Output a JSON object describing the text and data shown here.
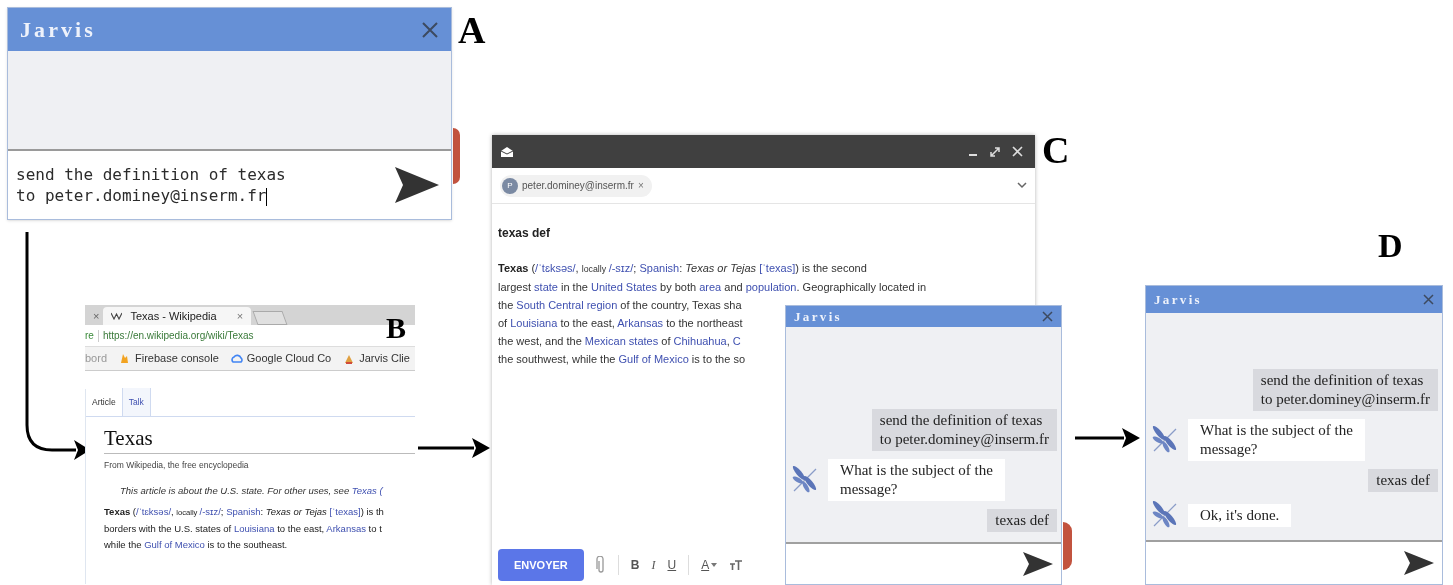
{
  "panel_a": {
    "label": "A",
    "chat": {
      "title": "Jarvis",
      "input": {
        "value": "send the definition of texas\nto peter.dominey@inserm.fr"
      }
    }
  },
  "panel_b": {
    "label": "B",
    "tabs": [
      {
        "label": "×",
        "selected": false
      },
      {
        "label": "Texas - Wikipedia",
        "close": "×",
        "selected": true
      }
    ],
    "address": {
      "security": "re",
      "url": "https://en.wikipedia.org/wiki/Texas"
    },
    "bookmarks": [
      {
        "label": "bord",
        "kind": "plain"
      },
      {
        "label": "Firebase console",
        "kind": "flame"
      },
      {
        "label": "Google Cloud Co",
        "kind": "cloud"
      },
      {
        "label": "Jarvis Clie",
        "kind": "app"
      }
    ],
    "page_tabs": [
      {
        "label": "Article",
        "selected": true
      },
      {
        "label": "Talk",
        "selected": false
      }
    ],
    "heading": "Texas",
    "tagline": "From Wikipedia, the free encyclopedia",
    "hatnote": [
      {
        "text": "This article is about the U.S. state. For other uses, see ",
        "kind": "plain"
      },
      {
        "text": "Texas (",
        "kind": "link"
      }
    ],
    "paragraph": [
      [
        {
          "text": "Texas",
          "kind": "bold"
        },
        {
          "text": " (",
          "kind": "plain"
        },
        {
          "text": "/ˈtɛksəs/",
          "kind": "link"
        },
        {
          "text": ", ",
          "kind": "plain"
        },
        {
          "text": "locally ",
          "kind": "small"
        },
        {
          "text": "/-sɪz/",
          "kind": "link"
        },
        {
          "text": "; ",
          "kind": "plain"
        },
        {
          "text": "Spanish",
          "kind": "link"
        },
        {
          "text": ": ",
          "kind": "plain"
        },
        {
          "text": "Texas or Tejas ",
          "kind": "italic"
        },
        {
          "text": "[ˈtexas]",
          "kind": "link"
        },
        {
          "text": ") is th",
          "kind": "plain"
        }
      ],
      [
        {
          "text": "borders with the U.S. states of ",
          "kind": "plain"
        },
        {
          "text": "Louisiana",
          "kind": "link"
        },
        {
          "text": " to the east, ",
          "kind": "plain"
        },
        {
          "text": "Arkansas",
          "kind": "link"
        },
        {
          "text": " to t",
          "kind": "plain"
        }
      ],
      [
        {
          "text": "while the ",
          "kind": "plain"
        },
        {
          "text": "Gulf of Mexico",
          "kind": "link"
        },
        {
          "text": " is to the southeast.",
          "kind": "plain"
        }
      ]
    ]
  },
  "panel_c": {
    "label": "C",
    "recipient": {
      "initial": "P",
      "email": "peter.dominey@inserm.fr",
      "remove": "×"
    },
    "subject": "texas def",
    "body": [
      [
        {
          "text": "Texas",
          "kind": "bold"
        },
        {
          "text": " (",
          "kind": "plain"
        },
        {
          "text": "/ˈtɛksəs/",
          "kind": "link"
        },
        {
          "text": ", ",
          "kind": "plain"
        },
        {
          "text": "locally ",
          "kind": "small"
        },
        {
          "text": "/-sɪz/",
          "kind": "link"
        },
        {
          "text": "; ",
          "kind": "plain"
        },
        {
          "text": "Spanish",
          "kind": "link"
        },
        {
          "text": ": ",
          "kind": "plain"
        },
        {
          "text": "Texas or Tejas ",
          "kind": "italic"
        },
        {
          "text": "[ˈtexas]",
          "kind": "link"
        },
        {
          "text": ") is the second",
          "kind": "plain"
        }
      ],
      [
        {
          "text": "largest ",
          "kind": "plain"
        },
        {
          "text": "state",
          "kind": "link"
        },
        {
          "text": " in the ",
          "kind": "plain"
        },
        {
          "text": "United States",
          "kind": "link"
        },
        {
          "text": " by both ",
          "kind": "plain"
        },
        {
          "text": "area",
          "kind": "link"
        },
        {
          "text": " and ",
          "kind": "plain"
        },
        {
          "text": "population",
          "kind": "link"
        },
        {
          "text": ". Geographically located in",
          "kind": "plain"
        }
      ],
      [
        {
          "text": "the ",
          "kind": "plain"
        },
        {
          "text": "South Central region",
          "kind": "link"
        },
        {
          "text": " of the country, Texas sha",
          "kind": "plain"
        }
      ],
      [
        {
          "text": "of ",
          "kind": "plain"
        },
        {
          "text": "Louisiana",
          "kind": "link"
        },
        {
          "text": " to the east, ",
          "kind": "plain"
        },
        {
          "text": "Arkansas",
          "kind": "link"
        },
        {
          "text": " to the northeast",
          "kind": "plain"
        }
      ],
      [
        {
          "text": "the west, and the ",
          "kind": "plain"
        },
        {
          "text": "Mexican states",
          "kind": "link"
        },
        {
          "text": " of ",
          "kind": "plain"
        },
        {
          "text": "Chihuahua",
          "kind": "link"
        },
        {
          "text": ", ",
          "kind": "plain"
        },
        {
          "text": "C",
          "kind": "link"
        }
      ],
      [
        {
          "text": "the southwest, while the ",
          "kind": "plain"
        },
        {
          "text": "Gulf of Mexico",
          "kind": "link"
        },
        {
          "text": " is to the so",
          "kind": "plain"
        }
      ]
    ],
    "send_button": "ENVOYER",
    "format_buttons": [
      {
        "label": "B",
        "kind": "bold"
      },
      {
        "label": "I",
        "kind": "italic"
      },
      {
        "label": "U",
        "kind": "underline"
      },
      {
        "label": "A",
        "kind": "color"
      }
    ],
    "chat": {
      "title": "Jarvis",
      "messages": [
        {
          "kind": "user",
          "text": "send the definition of texas\nto peter.dominey@inserm.fr"
        },
        {
          "kind": "bot",
          "text": "What is the subject of the\nmessage?"
        },
        {
          "kind": "user",
          "text": "texas def"
        }
      ]
    }
  },
  "panel_d": {
    "label": "D",
    "chat": {
      "title": "Jarvis",
      "messages": [
        {
          "kind": "user",
          "text": "send the definition of texas\nto peter.dominey@inserm.fr"
        },
        {
          "kind": "bot",
          "text": "What is the subject of the\nmessage?"
        },
        {
          "kind": "user",
          "text": "texas def"
        },
        {
          "kind": "bot",
          "text": "Ok, it's done."
        }
      ]
    }
  }
}
